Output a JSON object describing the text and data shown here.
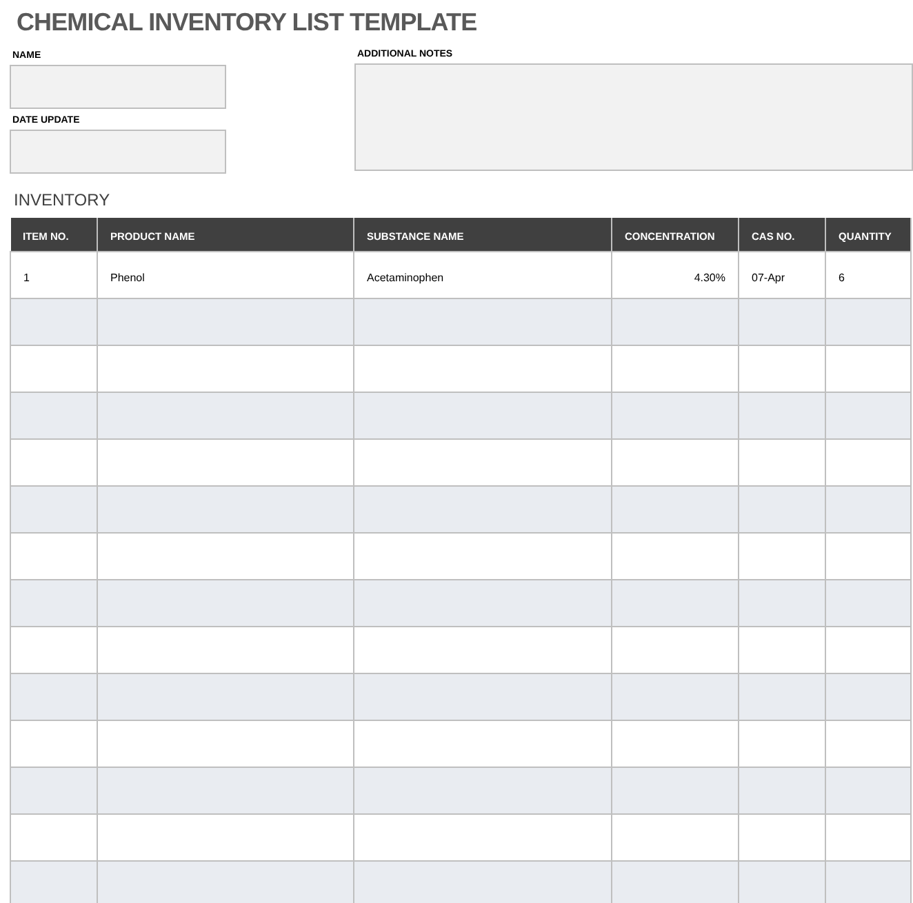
{
  "title": "CHEMICAL INVENTORY LIST TEMPLATE",
  "fields": [
    {
      "label": "NAME"
    },
    {
      "label": "DATE UPDATE"
    }
  ],
  "notes": {
    "label": "ADDITIONAL NOTES"
  },
  "section": "INVENTORY",
  "table": {
    "columns": [
      "ITEM NO.",
      "PRODUCT NAME",
      "SUBSTANCE NAME",
      "CONCENTRATION",
      "CAS NO.",
      "QUANTITY"
    ],
    "rows": [
      [
        "1",
        "Phenol",
        "Acetaminophen",
        "4.30%",
        "07-Apr",
        "6"
      ]
    ]
  }
}
